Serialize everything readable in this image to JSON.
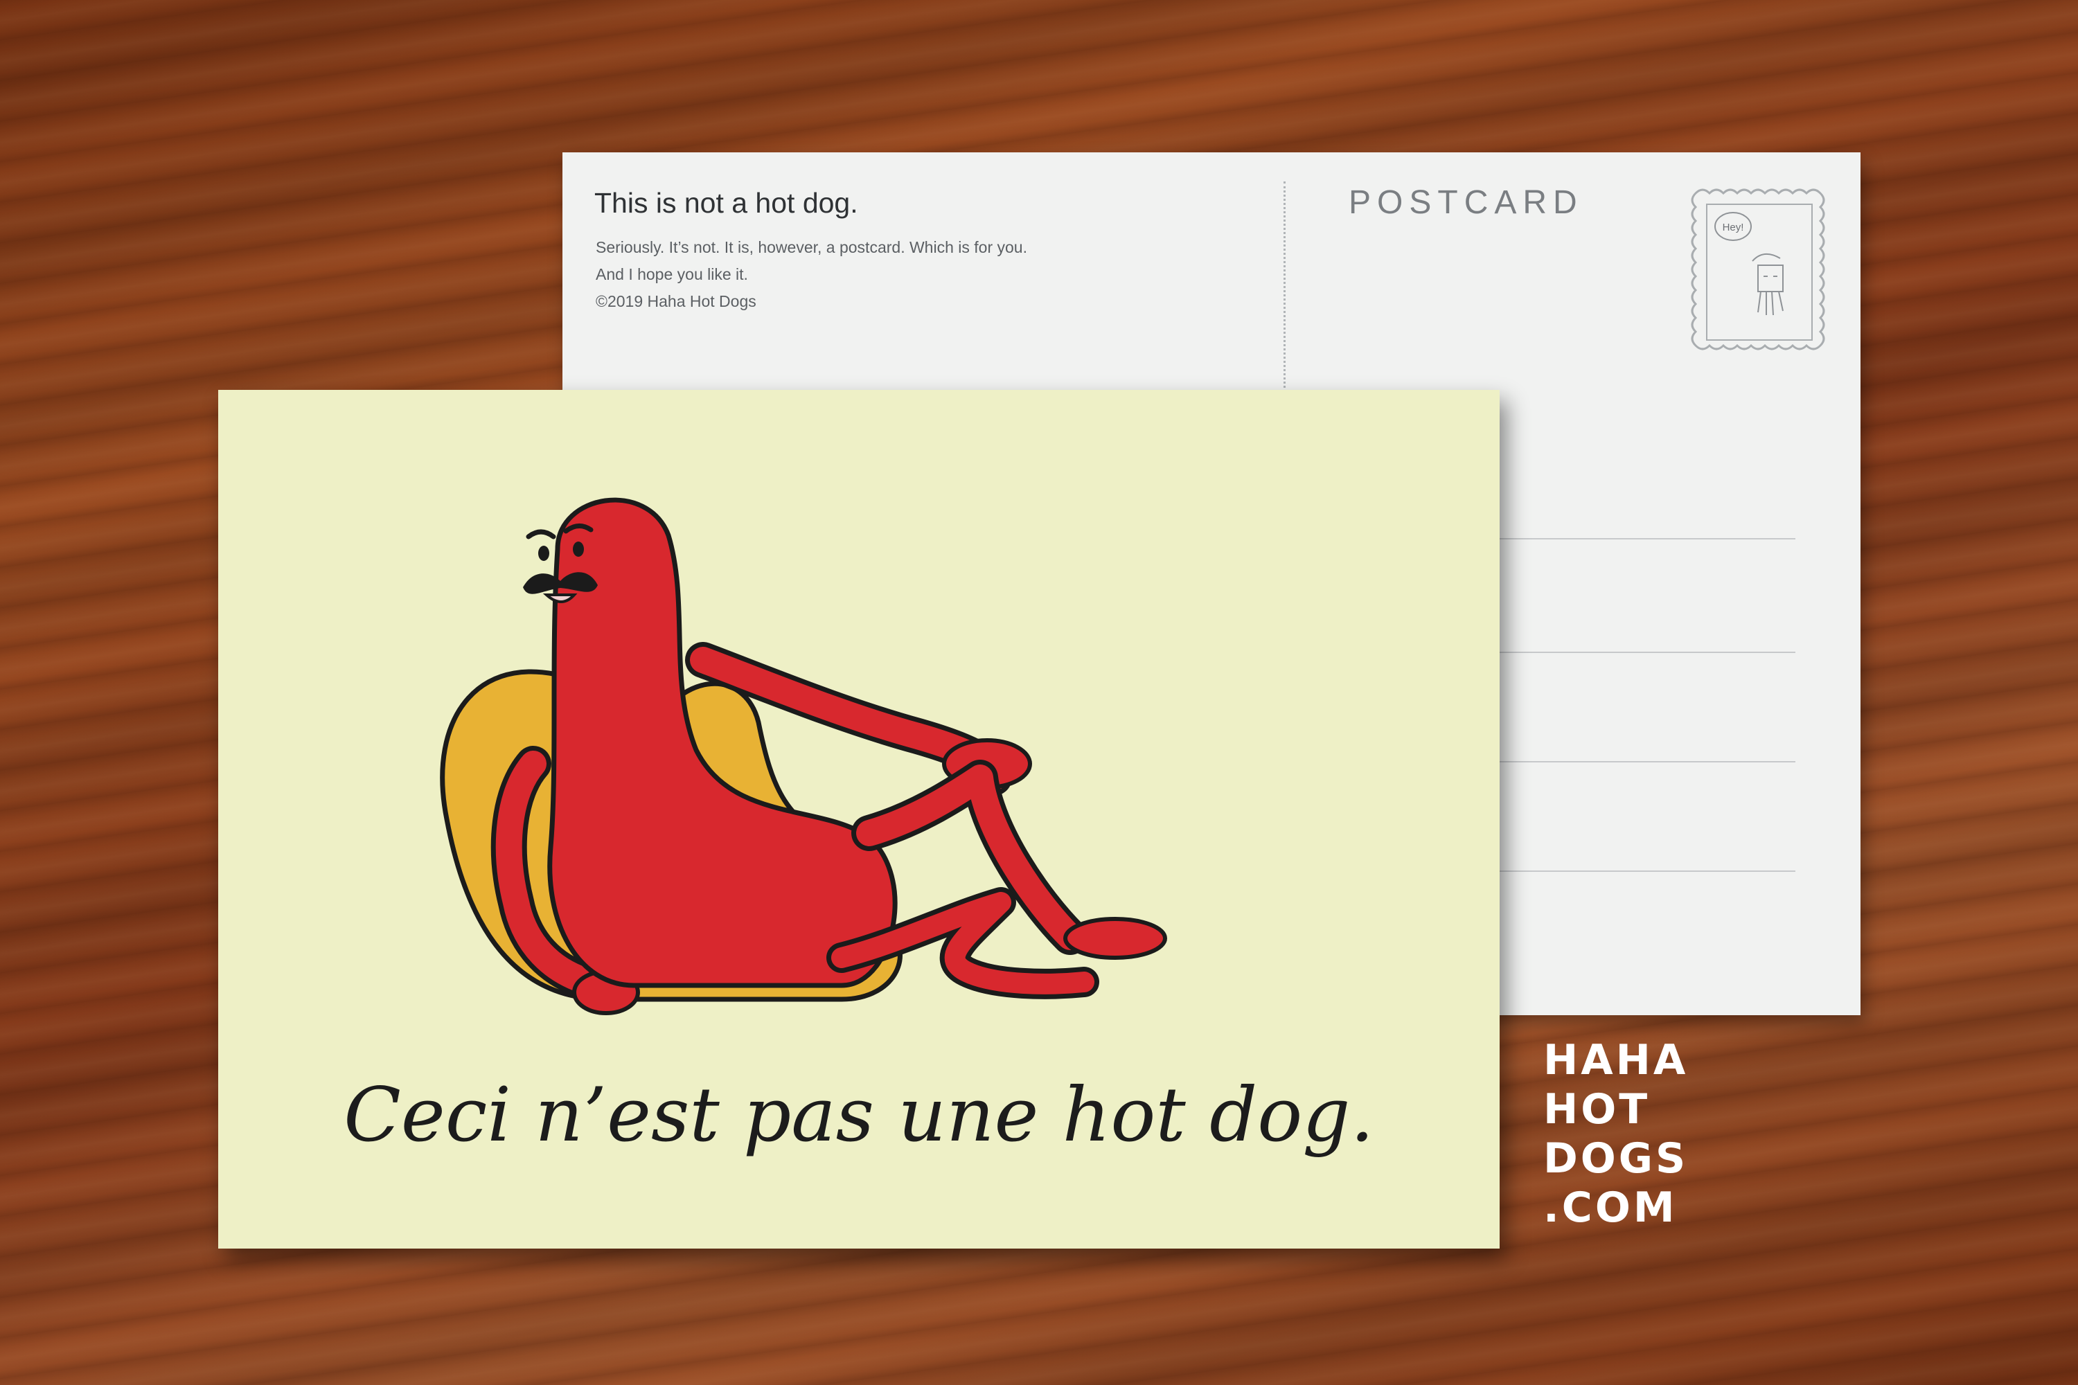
{
  "back": {
    "title": "This is not a hot dog.",
    "body_lines": [
      "Seriously. It’s not. It is, however, a postcard. Which is for you.",
      "And I hope you like it.",
      "©2019 Haha Hot Dogs"
    ],
    "postcard_label": "POSTCARD",
    "stamp_speech": "Hey!"
  },
  "front": {
    "caption": "Ceci n’est pas une hot dog."
  },
  "brand": {
    "lines": [
      "HAHA",
      "HOT",
      "DOGS",
      ".COM"
    ]
  },
  "colors": {
    "table_wood": "#8a3f1b",
    "card_back": "#f1f2f1",
    "card_front": "#eef0c6",
    "sausage": "#d8282e",
    "bun": "#e8b234",
    "brand_text": "#ffffff"
  }
}
